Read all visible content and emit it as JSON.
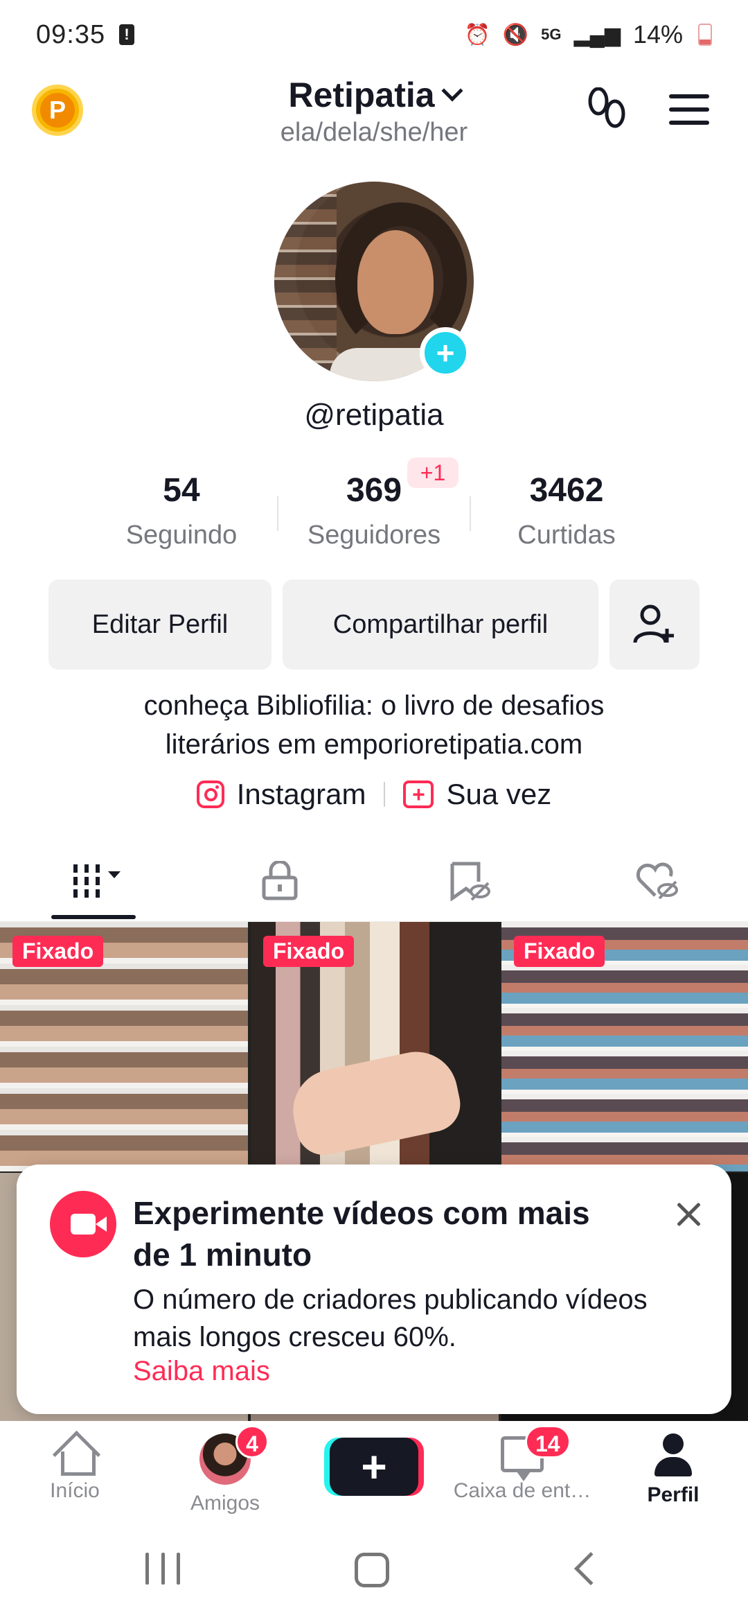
{
  "status_bar": {
    "time": "09:35",
    "battery": "14%",
    "network": "5G"
  },
  "header": {
    "profile_name": "Retipatia",
    "pronouns": "ela/dela/she/her",
    "coin_label": "P"
  },
  "profile": {
    "handle": "@retipatia",
    "stats": {
      "following": {
        "value": "54",
        "label": "Seguindo"
      },
      "followers": {
        "value": "369",
        "label": "Seguidores",
        "badge": "+1"
      },
      "likes": {
        "value": "3462",
        "label": "Curtidas"
      }
    },
    "buttons": {
      "edit": "Editar Perfil",
      "share": "Compartilhar perfil"
    },
    "bio_line1": "conheça Bibliofilia: o livro de desafios",
    "bio_line2": "literários em emporioretipatia.com",
    "links": {
      "instagram": "Instagram",
      "your_turn": "Sua vez"
    }
  },
  "tabs": [
    {
      "name": "videos",
      "icon": "grid-icon",
      "active": true
    },
    {
      "name": "private",
      "icon": "lock-icon"
    },
    {
      "name": "saved",
      "icon": "bookmark-hidden-icon"
    },
    {
      "name": "liked",
      "icon": "heart-hidden-icon"
    }
  ],
  "grid": {
    "pinned_label": "Fixado"
  },
  "popup": {
    "title": "Experimente vídeos com mais de 1 minuto",
    "body": "O número de criadores publicando vídeos mais longos cresceu 60%.",
    "link": "Saiba mais"
  },
  "bottom_nav": {
    "home": "Início",
    "friends": "Amigos",
    "friends_badge": "4",
    "inbox": "Caixa de ent…",
    "inbox_badge": "14",
    "profile": "Perfil"
  },
  "colors": {
    "accent": "#fe2c55",
    "cyan": "#20d5ec"
  }
}
